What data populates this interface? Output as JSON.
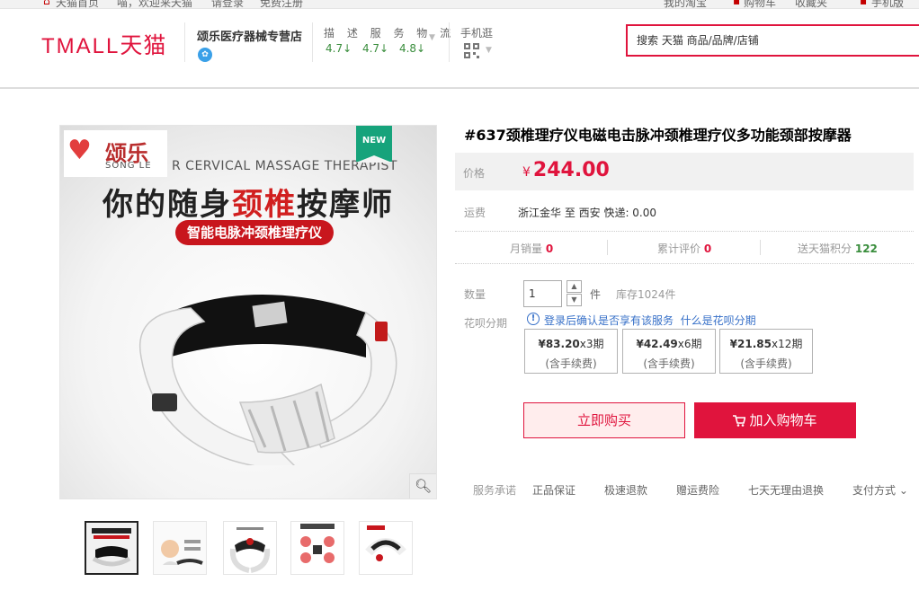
{
  "topbar": {
    "home": "天猫首页",
    "welcome": "喵，欢迎来天猫",
    "login": "请登录",
    "register": "免费注册",
    "my_taobao": "我的淘宝",
    "cart": "购物车",
    "favorites": "收藏夹",
    "mobile": "手机版"
  },
  "header": {
    "logo_en": "TMALL",
    "logo_cn": "天猫",
    "shop_name": "颂乐医疗器械专营店",
    "rating_label": "描 述 服 务 物 流",
    "ratings": [
      "4.7↓",
      "4.7↓",
      "4.8↓"
    ],
    "mobile_label": "手机逛",
    "search_placeholder": "搜索 天猫 商品/品牌/店铺"
  },
  "gallery": {
    "brand_cn": "颂乐",
    "brand_en": "SONG LE",
    "img_en": "R CERVICAL MASSAGE THERAPIST",
    "img_title_a": "你的随身",
    "img_title_hl": "颈椎",
    "img_title_b": "按摩师",
    "img_pill": "智能电脉冲颈椎理疗仪",
    "new_badge": "NEW"
  },
  "product": {
    "title": "#637颈椎理疗仪电磁电击脉冲颈椎理疗仪多功能颈部按摩器",
    "price_label": "价格",
    "price_currency": "¥",
    "price": "244.00",
    "ship_label": "运费",
    "ship_text": "浙江金华  至 西安  快递: 0.00",
    "monthly_sales_label": "月销量",
    "monthly_sales": "0",
    "reviews_label": "累计评价",
    "reviews": "0",
    "points_label": "送天猫积分",
    "points": "122",
    "qty_label": "数量",
    "qty_value": "1",
    "qty_unit": "件",
    "stock": "库存1024件",
    "huabei_label": "花呗分期",
    "huabei_note": "登录后确认是否享有该服务",
    "huabei_link": "什么是花呗分期",
    "installments": [
      {
        "amount": "¥83.20",
        "period": "x3期",
        "fee": "(含手续费)"
      },
      {
        "amount": "¥42.49",
        "period": "x6期",
        "fee": "(含手续费)"
      },
      {
        "amount": "¥21.85",
        "period": "x12期",
        "fee": "(含手续费)"
      }
    ],
    "buy_now": "立即购买",
    "add_to_cart": "加入购物车"
  },
  "service": {
    "label": "服务承诺",
    "items": [
      "正品保证",
      "极速退款",
      "赠运费险",
      "七天无理由退换"
    ],
    "payment": "支付方式"
  },
  "colors": {
    "accent": "#e0143d",
    "rating_green": "#398d3c",
    "link_blue": "#3770c8"
  }
}
